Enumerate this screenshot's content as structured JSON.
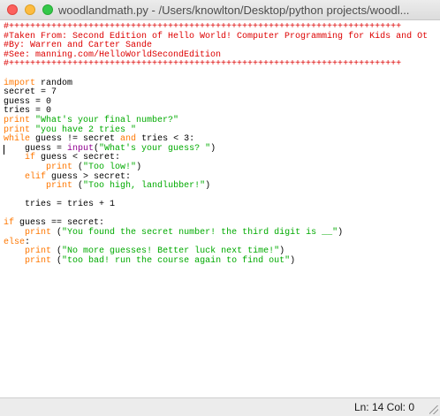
{
  "window": {
    "title": "woodlandmath.py - /Users/knowlton/Desktop/python projects/woodl..."
  },
  "editor": {
    "lines": [
      [
        {
          "t": "#++++++++++++++++++++++++++++++++++++++++++++++++++++++++++++++++++++++++++",
          "c": "comment"
        }
      ],
      [
        {
          "t": "#Taken From: Second Edition of Hello World! Computer Programming for Kids and Ot",
          "c": "comment"
        }
      ],
      [
        {
          "t": "#By: Warren and Carter Sande",
          "c": "comment"
        }
      ],
      [
        {
          "t": "#See: manning.com/HelloWorldSecondEdition",
          "c": "comment"
        }
      ],
      [
        {
          "t": "#++++++++++++++++++++++++++++++++++++++++++++++++++++++++++++++++++++++++++",
          "c": "comment"
        }
      ],
      [],
      [
        {
          "t": "import",
          "c": "keyword"
        },
        {
          "t": " random",
          "c": "default"
        }
      ],
      [
        {
          "t": "secret = 7",
          "c": "default"
        }
      ],
      [
        {
          "t": "guess = 0",
          "c": "default"
        }
      ],
      [
        {
          "t": "tries = 0",
          "c": "default"
        }
      ],
      [
        {
          "t": "print",
          "c": "keyword"
        },
        {
          "t": " \"What's your final number?\"",
          "c": "string"
        }
      ],
      [
        {
          "t": "print",
          "c": "keyword"
        },
        {
          "t": " \"you have 2 tries \"",
          "c": "string"
        }
      ],
      [
        {
          "t": "while",
          "c": "keyword"
        },
        {
          "t": " guess != secret ",
          "c": "default"
        },
        {
          "t": "and",
          "c": "keyword"
        },
        {
          "t": " tries < 3:",
          "c": "default"
        }
      ],
      [
        {
          "t": "    guess = ",
          "c": "default"
        },
        {
          "t": "input",
          "c": "builtin"
        },
        {
          "t": "(",
          "c": "default"
        },
        {
          "t": "\"What's your guess? \"",
          "c": "string"
        },
        {
          "t": ")",
          "c": "default"
        }
      ],
      [
        {
          "t": "    ",
          "c": "default"
        },
        {
          "t": "if",
          "c": "keyword"
        },
        {
          "t": " guess < secret:",
          "c": "default"
        }
      ],
      [
        {
          "t": "        ",
          "c": "default"
        },
        {
          "t": "print",
          "c": "keyword"
        },
        {
          "t": " (",
          "c": "default"
        },
        {
          "t": "\"Too low!\"",
          "c": "string"
        },
        {
          "t": ")",
          "c": "default"
        }
      ],
      [
        {
          "t": "    ",
          "c": "default"
        },
        {
          "t": "elif",
          "c": "keyword"
        },
        {
          "t": " guess > secret:",
          "c": "default"
        }
      ],
      [
        {
          "t": "        ",
          "c": "default"
        },
        {
          "t": "print",
          "c": "keyword"
        },
        {
          "t": " (",
          "c": "default"
        },
        {
          "t": "\"Too high, landlubber!\"",
          "c": "string"
        },
        {
          "t": ")",
          "c": "default"
        }
      ],
      [],
      [
        {
          "t": "    tries = tries + 1",
          "c": "default"
        }
      ],
      [],
      [
        {
          "t": "if",
          "c": "keyword"
        },
        {
          "t": " guess == secret:",
          "c": "default"
        }
      ],
      [
        {
          "t": "    ",
          "c": "default"
        },
        {
          "t": "print",
          "c": "keyword"
        },
        {
          "t": " (",
          "c": "default"
        },
        {
          "t": "\"You found the secret number! the third digit is __\"",
          "c": "string"
        },
        {
          "t": ")",
          "c": "default"
        }
      ],
      [
        {
          "t": "else",
          "c": "keyword"
        },
        {
          "t": ":",
          "c": "default"
        }
      ],
      [
        {
          "t": "    ",
          "c": "default"
        },
        {
          "t": "print",
          "c": "keyword"
        },
        {
          "t": " (",
          "c": "default"
        },
        {
          "t": "\"No more guesses! Better luck next time!\"",
          "c": "string"
        },
        {
          "t": ")",
          "c": "default"
        }
      ],
      [
        {
          "t": "    ",
          "c": "default"
        },
        {
          "t": "print",
          "c": "keyword"
        },
        {
          "t": " (",
          "c": "default"
        },
        {
          "t": "\"too bad! run the course again to find out\"",
          "c": "string"
        },
        {
          "t": ")",
          "c": "default"
        }
      ]
    ],
    "colors": {
      "comment": "#dd0000",
      "keyword": "#ff7700",
      "builtin": "#900090",
      "string": "#00aa00",
      "default": "#000000"
    },
    "cursor_line": 14
  },
  "status": {
    "position": "Ln: 14  Col: 0"
  }
}
